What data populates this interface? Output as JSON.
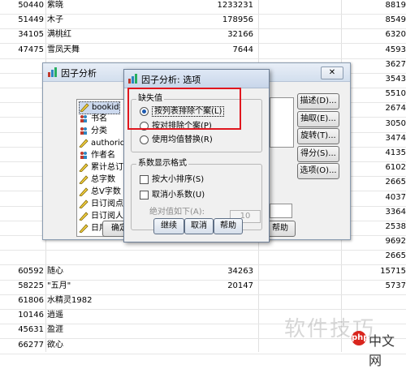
{
  "grid": {
    "rows": [
      {
        "id": "50440",
        "name": "紫晓",
        "v1": "1233231",
        "v2": "8819"
      },
      {
        "id": "51449",
        "name": "木子",
        "v1": "178956",
        "v2": "8549"
      },
      {
        "id": "34105",
        "name": "满桃红",
        "v1": "32166",
        "v2": "6320"
      },
      {
        "id": "47475",
        "name": "雪凤天舞",
        "v1": "7644",
        "v2": "4593"
      },
      {
        "id": "",
        "name": "",
        "v1": "",
        "v2": "3627"
      },
      {
        "id": "",
        "name": "",
        "v1": "",
        "v2": "3543"
      },
      {
        "id": "",
        "name": "",
        "v1": "",
        "v2": "5510"
      },
      {
        "id": "",
        "name": "",
        "v1": "",
        "v2": "2674"
      },
      {
        "id": "",
        "name": "",
        "v1": "",
        "v2": "3050"
      },
      {
        "id": "",
        "name": "",
        "v1": "",
        "v2": "3474"
      },
      {
        "id": "",
        "name": "",
        "v1": "",
        "v2": "4135"
      },
      {
        "id": "",
        "name": "",
        "v1": "",
        "v2": "6102"
      },
      {
        "id": "",
        "name": "",
        "v1": "",
        "v2": "2665"
      },
      {
        "id": "",
        "name": "",
        "v1": "",
        "v2": "4037"
      },
      {
        "id": "",
        "name": "",
        "v1": "",
        "v2": "3364"
      },
      {
        "id": "",
        "name": "",
        "v1": "",
        "v2": "2538"
      },
      {
        "id": "",
        "name": "",
        "v1": "",
        "v2": "9692"
      },
      {
        "id": "",
        "name": "",
        "v1": "",
        "v2": "2665"
      },
      {
        "id": "60592",
        "name": "随心",
        "v1": "34263",
        "v2": "15715"
      },
      {
        "id": "58225",
        "name": "\"五月\"",
        "v1": "20147",
        "v2": "5737"
      },
      {
        "id": "61806",
        "name": "水精灵1982",
        "v1": "",
        "v2": ""
      },
      {
        "id": "10146",
        "name": "逍遥",
        "v1": "",
        "v2": ""
      },
      {
        "id": "45631",
        "name": "盈涯",
        "v1": "",
        "v2": ""
      },
      {
        "id": "66277",
        "name": "欲心",
        "v1": "",
        "v2": ""
      }
    ]
  },
  "factor_dialog": {
    "title": "因子分析",
    "close_label": "✕",
    "variables": [
      "bookid",
      "书名",
      "分类",
      "authorid",
      "作者名",
      "累计总订阅点数",
      "总字数",
      "总V字数",
      "日订阅点数和",
      "日订阅人数和",
      "日用户和"
    ],
    "buttons": {
      "descriptives": "描述(D)...",
      "extraction": "抽取(E)...",
      "rotation": "旋转(T)...",
      "scores": "得分(S)...",
      "options": "选项(O)...",
      "ok": "确定",
      "help": "帮助"
    }
  },
  "options_dialog": {
    "title": "因子分析: 选项",
    "missing_group": "缺失值",
    "missing_options": [
      {
        "label": "按列表排除个案(L)",
        "selected": true
      },
      {
        "label": "按对排除个案(P)",
        "selected": false
      },
      {
        "label": "使用均值替换(R)",
        "selected": false
      }
    ],
    "format_group": "系数显示格式",
    "format_options": [
      {
        "label": "按大小排序(S)",
        "checked": false
      },
      {
        "label": "取消小系数(U)",
        "checked": false
      }
    ],
    "abs_label": "绝对值如下(A):",
    "abs_value": "10",
    "buttons": {
      "continue": "继续",
      "cancel": "取消",
      "help": "帮助"
    }
  },
  "watermark": {
    "text": "软件技巧",
    "logo": "php",
    "logo_text": "中文网"
  },
  "colors": {
    "highlight": "#e0161e",
    "selection": "#ccd9ee"
  }
}
